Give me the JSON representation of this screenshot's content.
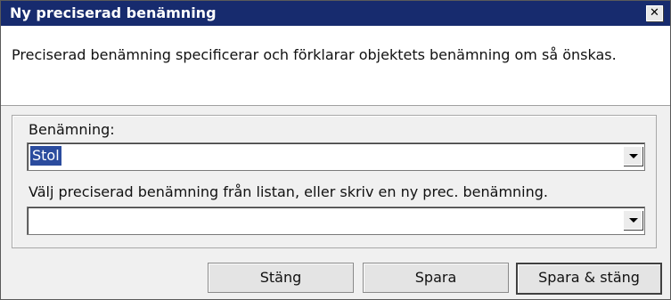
{
  "window": {
    "title": "Ny preciserad benämning",
    "close_glyph": "✕"
  },
  "info": {
    "text": "Preciserad benämning specificerar och förklarar objektets benämning om så önskas."
  },
  "form": {
    "name_label": "Benämning:",
    "name_value": "Stol",
    "precise_label": "Välj preciserad benämning från listan, eller skriv en ny prec. benämning.",
    "precise_value": ""
  },
  "buttons": {
    "close": "Stäng",
    "save": "Spara",
    "save_close": "Spara & stäng"
  },
  "colors": {
    "titlebar": "#172b6e",
    "selection": "#2b4c9e"
  }
}
